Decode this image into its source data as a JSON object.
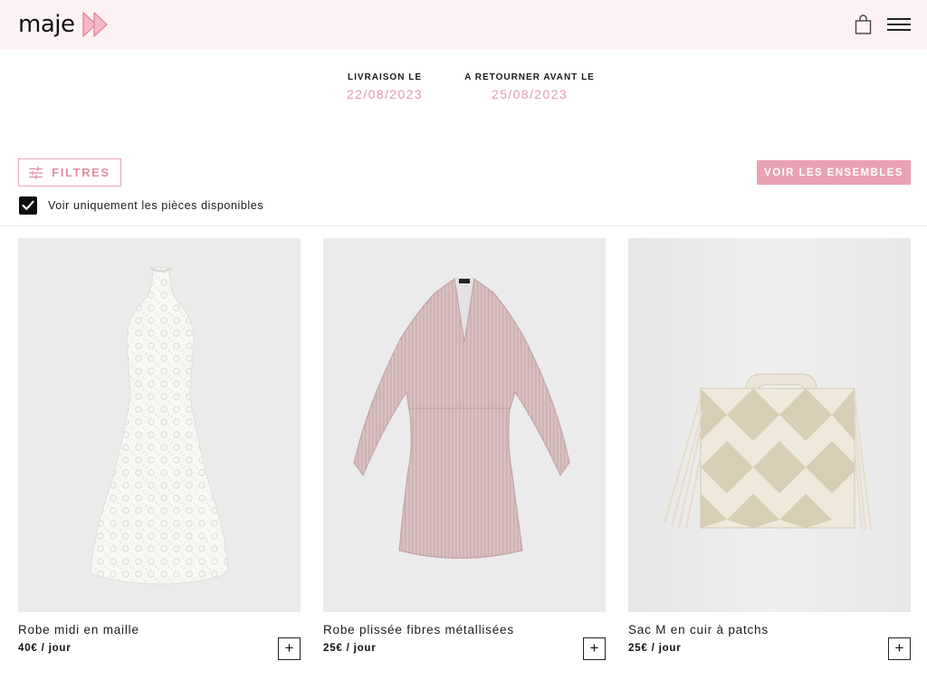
{
  "header": {
    "logo_text": "maje",
    "icons": [
      "logo-arrows-icon",
      "shopping-bag-icon",
      "hamburger-menu-icon"
    ]
  },
  "rental_dates": {
    "delivery_label": "LIVRAISON LE",
    "delivery_date": "22/08/2023",
    "return_label": "A RETOURNER AVANT LE",
    "return_date": "25/08/2023"
  },
  "toolbar": {
    "filters_label": "FILTRES",
    "ensembles_label": "VOIR LES ENSEMBLES",
    "availability_label": "Voir uniquement les pièces disponibles",
    "availability_checked": true
  },
  "colors": {
    "accent_pink": "#e9a2b4",
    "date_pink": "#e49aad",
    "header_bg": "#fcf2f4"
  },
  "products": [
    {
      "name": "Robe midi en maille",
      "price": "40€ / jour",
      "add_label": "+",
      "image": "white-lace-halter-midi-dress"
    },
    {
      "name": "Robe plissée fibres métallisées",
      "price": "25€ / jour",
      "add_label": "+",
      "image": "pink-metallic-pleated-wrap-dress"
    },
    {
      "name": "Sac M en cuir à patchs",
      "price": "25€ / jour",
      "add_label": "+",
      "image": "cream-patchwork-leather-fringe-bag"
    }
  ]
}
